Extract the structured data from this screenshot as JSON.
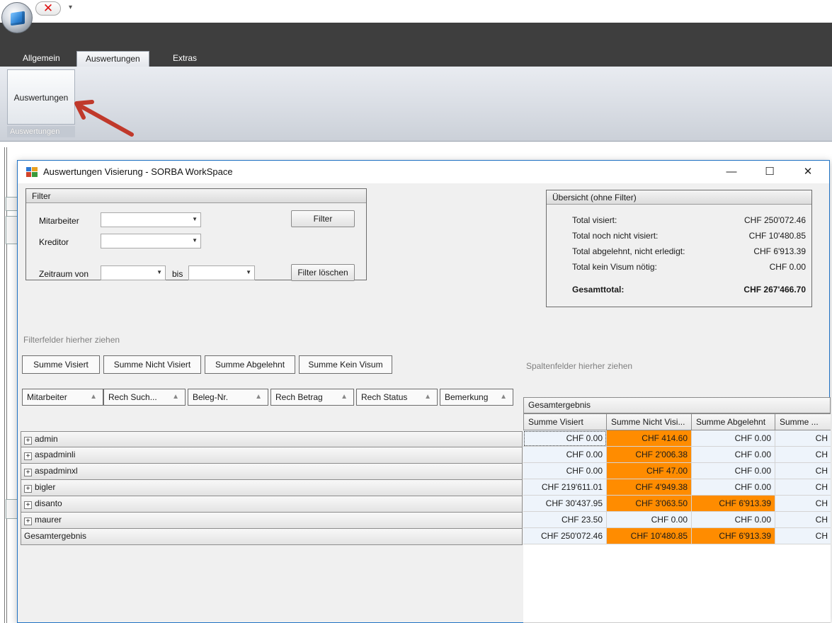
{
  "ribbon": {
    "tabs": [
      {
        "label": "Allgemein",
        "active": false
      },
      {
        "label": "Auswertungen",
        "active": true
      },
      {
        "label": "Extras",
        "active": false
      }
    ],
    "button_label": "Auswertungen",
    "group_label": "Auswertungen"
  },
  "dialog": {
    "title": "Auswertungen Visierung - SORBA WorkSpace",
    "filter": {
      "header": "Filter",
      "mitarbeiter_label": "Mitarbeiter",
      "kreditor_label": "Kreditor",
      "zeitraum_label": "Zeitraum von",
      "bis_label": "bis",
      "filter_button": "Filter",
      "clear_button": "Filter löschen"
    },
    "summary": {
      "header": "Übersicht (ohne Filter)",
      "rows": [
        {
          "label": "Total visiert:",
          "value": "CHF 250'072.46"
        },
        {
          "label": "Total noch nicht visiert:",
          "value": "CHF 10'480.85"
        },
        {
          "label": "Total abgelehnt, nicht erledigt:",
          "value": "CHF 6'913.39"
        },
        {
          "label": "Total kein Visum nötig:",
          "value": "CHF 0.00"
        }
      ],
      "grand_label": "Gesamttotal:",
      "grand_value": "CHF 267'466.70"
    },
    "pivot": {
      "filter_hint": "Filterfelder hierher ziehen",
      "column_hint": "Spaltenfelder hierher ziehen",
      "data_fields": [
        "Summe Visiert",
        "Summe Nicht Visiert",
        "Summe Abgelehnt",
        "Summe Kein Visum"
      ],
      "row_fields": [
        "Mitarbeiter",
        "Rech Such...",
        "Beleg-Nr.",
        "Rech Betrag",
        "Rech Status",
        "Bemerkung"
      ],
      "column_grand": "Gesamtergebnis",
      "columns": [
        "Summe Visiert",
        "Summe Nicht Visi...",
        "Summe Abgelehnt",
        "Summe ..."
      ],
      "rows": [
        {
          "label": "admin",
          "expandable": true,
          "values": [
            "CHF 0.00",
            "CHF 414.60",
            "CHF 0.00",
            "CH"
          ],
          "highlight": [
            false,
            true,
            false,
            false
          ]
        },
        {
          "label": "aspadminli",
          "expandable": true,
          "values": [
            "CHF 0.00",
            "CHF 2'006.38",
            "CHF 0.00",
            "CH"
          ],
          "highlight": [
            false,
            true,
            false,
            false
          ]
        },
        {
          "label": "aspadminxl",
          "expandable": true,
          "values": [
            "CHF 0.00",
            "CHF 47.00",
            "CHF 0.00",
            "CH"
          ],
          "highlight": [
            false,
            true,
            false,
            false
          ]
        },
        {
          "label": "bigler",
          "expandable": true,
          "values": [
            "CHF 219'611.01",
            "CHF 4'949.38",
            "CHF 0.00",
            "CH"
          ],
          "highlight": [
            false,
            true,
            false,
            false
          ]
        },
        {
          "label": "disanto",
          "expandable": true,
          "values": [
            "CHF 30'437.95",
            "CHF 3'063.50",
            "CHF 6'913.39",
            "CH"
          ],
          "highlight": [
            false,
            true,
            true,
            false
          ]
        },
        {
          "label": "maurer",
          "expandable": true,
          "values": [
            "CHF 23.50",
            "CHF 0.00",
            "CHF 0.00",
            "CH"
          ],
          "highlight": [
            false,
            false,
            false,
            false
          ]
        },
        {
          "label": "Gesamtergebnis",
          "expandable": false,
          "values": [
            "CHF 250'072.46",
            "CHF 10'480.85",
            "CHF 6'913.39",
            "CH"
          ],
          "highlight": [
            false,
            true,
            true,
            false
          ]
        }
      ]
    }
  },
  "colors": {
    "highlight": "#ff8c00",
    "cell_bg": "#eef4fb",
    "window_border": "#1f72c4",
    "arrow": "#c0392b"
  }
}
